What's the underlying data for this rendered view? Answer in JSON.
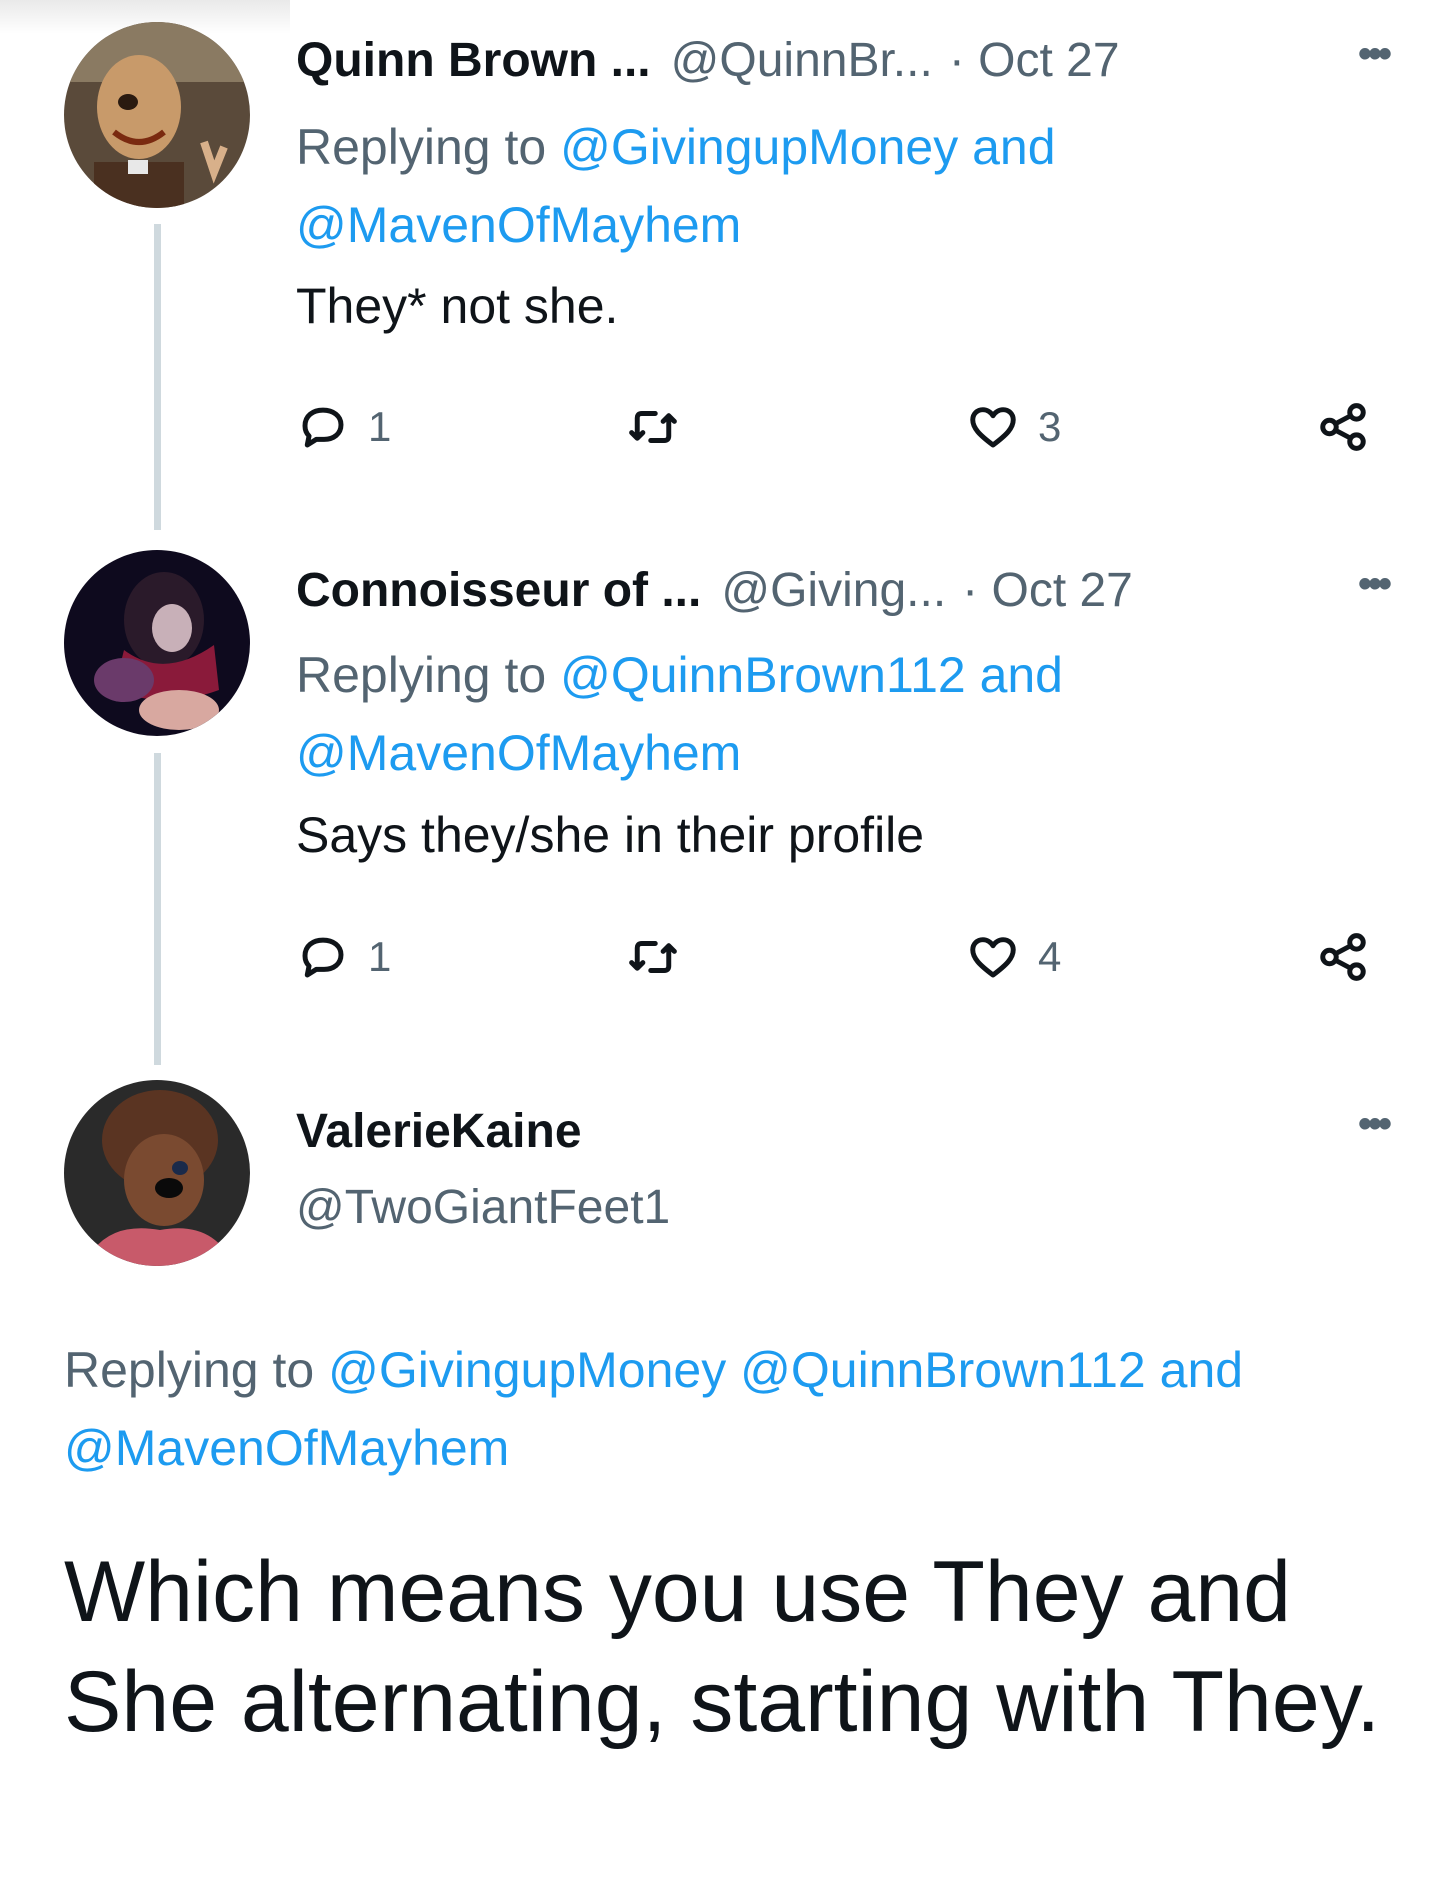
{
  "tweets": [
    {
      "name": "Quinn Brown ...",
      "handle": "@QuinnBr...",
      "date": "· Oct 27",
      "replying_prefix": "Replying to",
      "replying_link1": "@GivingupMoney and",
      "replying_link2": "@MavenOfMayhem",
      "text": "They* not she.",
      "reply_count": "1",
      "like_count": "3"
    },
    {
      "name": "Connoisseur of ...",
      "handle": "@Giving...",
      "date": "· Oct 27",
      "replying_prefix": "Replying to",
      "replying_link1": "@QuinnBrown112 and",
      "replying_link2": "@MavenOfMayhem",
      "text": "Says they/she in their profile",
      "reply_count": "1",
      "like_count": "4"
    }
  ],
  "main_tweet": {
    "name": "ValerieKaine",
    "handle": "@TwoGiantFeet1",
    "replying_prefix": "Replying to",
    "replying_links_line1": "@GivingupMoney @QuinnBrown112 and",
    "replying_links_line2": "@MavenOfMayhem",
    "text": "Which means you use They and She alternating, starting with They."
  },
  "icons": {
    "more": "more-icon",
    "reply": "reply-icon",
    "retweet": "retweet-icon",
    "like": "like-icon",
    "share": "share-icon"
  },
  "colors": {
    "link": "#1d9bf0",
    "muted": "#536471",
    "text": "#0f1419",
    "thread_line": "#cfd9de"
  }
}
